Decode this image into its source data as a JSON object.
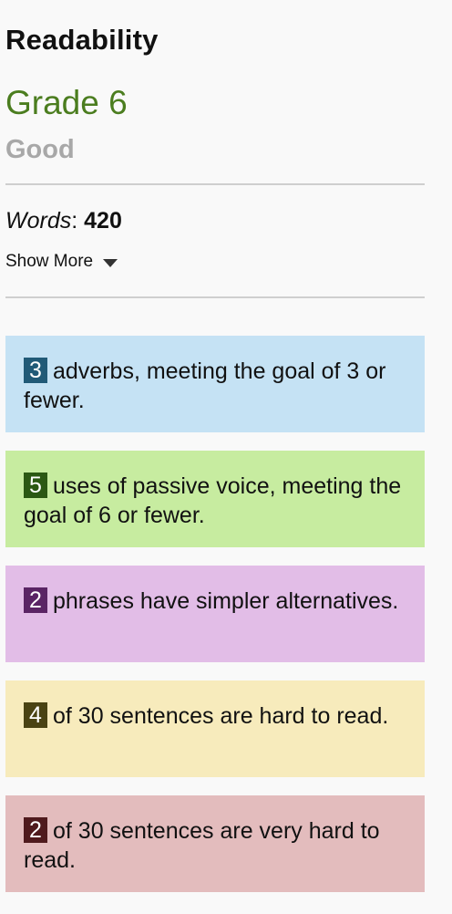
{
  "header": {
    "title": "Readability",
    "grade": "Grade 6",
    "quality": "Good"
  },
  "stats": {
    "words_label": "Words",
    "words_separator": ":",
    "words_value": "420",
    "show_more_label": "Show More"
  },
  "cards": [
    {
      "count": "3",
      "text": "adverbs, meeting the goal of 3 or fewer."
    },
    {
      "count": "5",
      "text": "uses of passive voice, meeting the goal of 6 or fewer."
    },
    {
      "count": "2",
      "text": "phrases have simpler alternatives."
    },
    {
      "count": "4",
      "text": "of 30 sentences are hard to read."
    },
    {
      "count": "2",
      "text": "of 30 sentences are very hard to read."
    }
  ],
  "colors": {
    "grade_green": "#4b7d1f",
    "adverbs_bg": "#c5e2f4",
    "passive_bg": "#c7eca0",
    "simpler_bg": "#e2bde7",
    "hard_bg": "#f7ebbc",
    "very_hard_bg": "#e3bcbd"
  },
  "icons": {
    "show_more": "caret-down-icon"
  }
}
